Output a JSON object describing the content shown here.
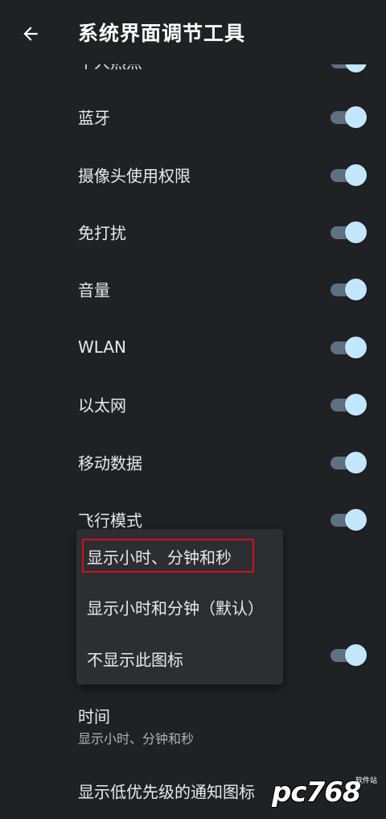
{
  "header": {
    "title": "系统界面调节工具",
    "back_icon": "arrow-left-icon"
  },
  "colors": {
    "background": "#202124",
    "switch_thumb": "#c3e6ff",
    "switch_track": "#5f7180",
    "popup_bg": "#2d2e31",
    "highlight": "#d0111b"
  },
  "settings": {
    "items": [
      {
        "label": "个人热点",
        "enabled": true
      },
      {
        "label": "蓝牙",
        "enabled": true
      },
      {
        "label": "摄像头使用权限",
        "enabled": true
      },
      {
        "label": "免打扰",
        "enabled": true
      },
      {
        "label": "音量",
        "enabled": true
      },
      {
        "label": "WLAN",
        "enabled": true
      },
      {
        "label": "以太网",
        "enabled": true
      },
      {
        "label": "移动数据",
        "enabled": true
      },
      {
        "label": "飞行模式",
        "enabled": true
      }
    ],
    "hidden_row_switch_enabled": true
  },
  "time": {
    "title": "时间",
    "summary": "显示小时、分钟和秒"
  },
  "low_priority": {
    "label": "显示低优先级的通知图标"
  },
  "popup_menu": {
    "options": [
      {
        "label": "显示小时、分钟和秒",
        "selected": true
      },
      {
        "label": "显示小时和分钟（默认）",
        "selected": false
      },
      {
        "label": "不显示此图标",
        "selected": false
      }
    ]
  },
  "watermark": {
    "logo": "pc768",
    "small_text": "软件站"
  }
}
